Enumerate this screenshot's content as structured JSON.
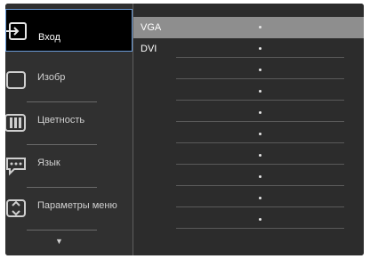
{
  "menu": {
    "items": [
      {
        "label": "Вход",
        "icon": "input-icon",
        "selected": true
      },
      {
        "label": "Изобр",
        "icon": "picture-icon",
        "selected": false
      },
      {
        "label": "Цветность",
        "icon": "color-icon",
        "selected": false
      },
      {
        "label": "Язык",
        "icon": "language-icon",
        "selected": false
      },
      {
        "label": "Параметры меню",
        "icon": "osd-settings-icon",
        "selected": false
      }
    ],
    "more_indicator": "▼"
  },
  "submenu": {
    "options": [
      {
        "label": "VGA",
        "selected": true
      },
      {
        "label": "DVI",
        "selected": false
      },
      {
        "label": "",
        "selected": false
      },
      {
        "label": "",
        "selected": false
      },
      {
        "label": "",
        "selected": false
      },
      {
        "label": "",
        "selected": false
      },
      {
        "label": "",
        "selected": false
      },
      {
        "label": "",
        "selected": false
      },
      {
        "label": "",
        "selected": false
      },
      {
        "label": "",
        "selected": false
      }
    ]
  },
  "colors": {
    "selection_border": "#6a9bd8",
    "selected_submenu": "#8e8e8e",
    "background": "#2b2b2b"
  }
}
